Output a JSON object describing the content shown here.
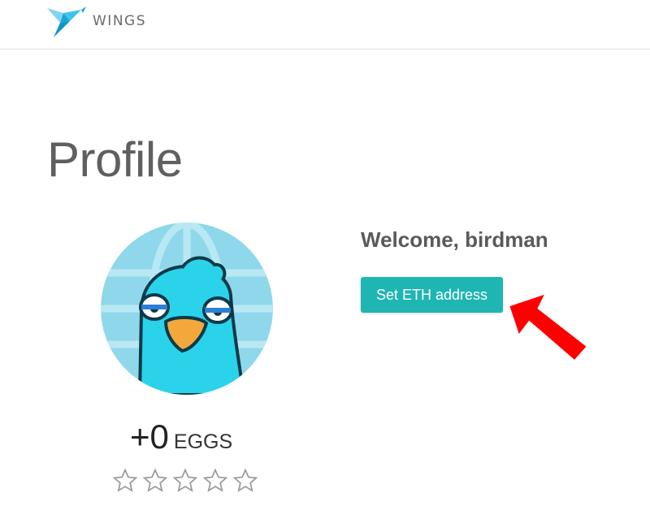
{
  "header": {
    "brand": "WINGS",
    "logo_icon": "origami-bird-icon"
  },
  "page": {
    "title": "Profile"
  },
  "profile": {
    "avatar_icon": "bird-avatar-icon",
    "eggs_count": "+0",
    "eggs_unit": "EGGS",
    "rating": {
      "value": 0,
      "max": 5
    },
    "welcome": "Welcome, birdman",
    "set_eth_label": "Set ETH address"
  },
  "colors": {
    "accent": "#1fb5b3",
    "logo": "#29b6e8",
    "annotation_arrow": "#ff0000"
  }
}
